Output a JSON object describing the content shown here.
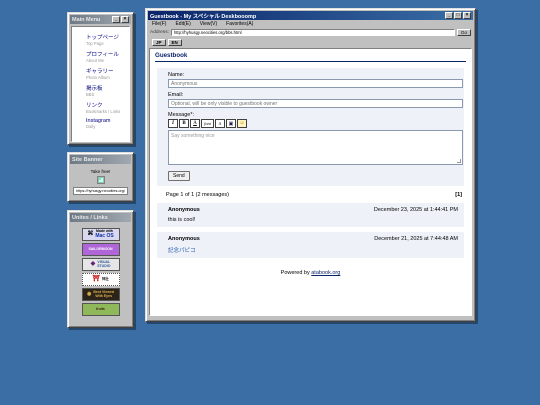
{
  "menu_window": {
    "title": "Main Menu",
    "items": [
      {
        "label": "トップページ",
        "sub": "Top Page"
      },
      {
        "label": "プロフィール",
        "sub": "About Me"
      },
      {
        "label": "ギャラリー",
        "sub": "Photo Album"
      },
      {
        "label": "掲示板",
        "sub": "BBS"
      },
      {
        "label": "リンク",
        "sub": "Bookmarks / Links"
      },
      {
        "label": "Instagram",
        "sub": "Daily"
      }
    ]
  },
  "banner_window": {
    "title": "Site Banner",
    "caption": "Take free!",
    "url": "https://hyhusgy.neocities.org/"
  },
  "links_window": {
    "title": "Unites / Links",
    "badges": [
      {
        "line1": "Made with",
        "line2": "Mac OS",
        "icon": "mac-logo-icon"
      },
      {
        "line1": "SAILORMOON",
        "line2": "",
        "icon": ""
      },
      {
        "line1": "VISUAL",
        "line2": "STUDIO",
        "icon": "visual-studio-icon"
      },
      {
        "line1": "神社",
        "line2": "",
        "icon": "shrine-icon"
      },
      {
        "line1": "Best Viewed",
        "line2": "With Eyes",
        "icon": "eye-icon"
      },
      {
        "line1": "fruits",
        "line2": "",
        "icon": ""
      }
    ]
  },
  "browser": {
    "title": "Guestbook - My スペシャル Deskbooomp",
    "menus": [
      "File(F)",
      "Edit(E)",
      "View(V)",
      "Favorites(A)"
    ],
    "address_label": "Address:",
    "address_value": "http://hyhusgy.neocities.org/bbs.html",
    "go_label": "Go",
    "toolbar_buttons": [
      "JP",
      "EN"
    ]
  },
  "guestbook": {
    "heading": "Guestbook",
    "name_label": "Name:",
    "name_placeholder": "Anonymous",
    "email_label": "Email:",
    "email_placeholder": "Optional, will be only visible to guestbook owner",
    "message_label": "Message*:",
    "format_buttons": [
      "I",
      "B",
      "A",
      "font",
      "A",
      "",
      "☺"
    ],
    "message_placeholder": "Say something nice",
    "send_label": "Send",
    "pager_text": "Page 1 of 1 (2 messages)",
    "pager_link": "[1]",
    "messages": [
      {
        "name": "Anonymous",
        "date": "December 23, 2025 at 1:44:41 PM",
        "text": "this is cool!"
      },
      {
        "name": "Anonymous",
        "date": "December 21, 2025 at 7:44:48 AM",
        "text": "記念パピコ"
      }
    ],
    "powered_prefix": "Powered by",
    "powered_link": "atabook.org"
  },
  "colors": {
    "desktop": "#3a6ea5",
    "titlebar_active": "#0a246a",
    "window_face": "#c0c0c0",
    "form_bg": "#eef2f8"
  }
}
